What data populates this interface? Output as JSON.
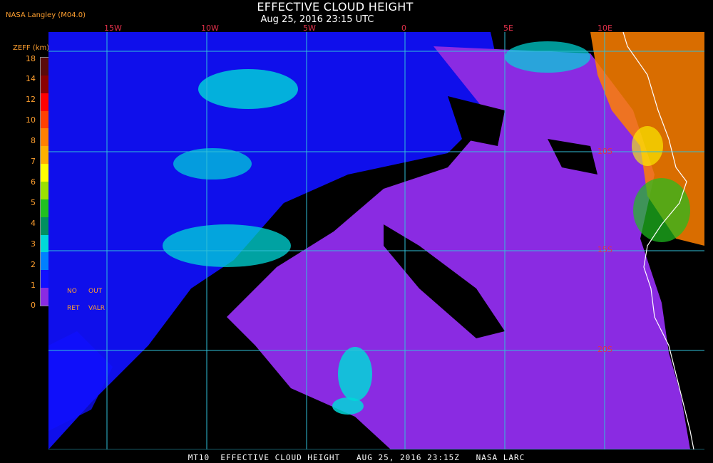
{
  "header": {
    "title": "EFFECTIVE CLOUD HEIGHT",
    "subtitle": "Aug 25, 2016 23:15 UTC",
    "source": "NASA Langley (M04.0)"
  },
  "legend": {
    "title": "ZEFF (km)",
    "ticks": [
      "18",
      "14",
      "12",
      "10",
      "8",
      "7",
      "6",
      "5",
      "4",
      "3",
      "2",
      "1",
      "0"
    ],
    "colors": [
      "#5a0a0a",
      "#8b0000",
      "#ff0000",
      "#ff4000",
      "#ff8000",
      "#ffb000",
      "#ffff00",
      "#9be000",
      "#20c020",
      "#009060",
      "#00d8d8",
      "#0080ff",
      "#1010ff",
      "#8a2be2"
    ],
    "notes": {
      "no": "NO",
      "out": "OUT",
      "ret": "RET",
      "valr": "VALR"
    }
  },
  "map": {
    "lon_labels": [
      "15W",
      "10W",
      "5W",
      "0",
      "5E",
      "10E"
    ],
    "lat_labels": [
      "10S",
      "15S",
      "20S"
    ],
    "colors": {
      "clear": "#000000",
      "low": "#8a2be2",
      "mid_low": "#1010ff",
      "mid": "#00d8d8",
      "high": "#ff8000",
      "grid": "#30c0d8",
      "coast": "#ffffff"
    }
  },
  "footer": {
    "caption": "MT10  EFFECTIVE CLOUD HEIGHT   AUG 25, 2016 23:15Z   NASA LARC"
  }
}
